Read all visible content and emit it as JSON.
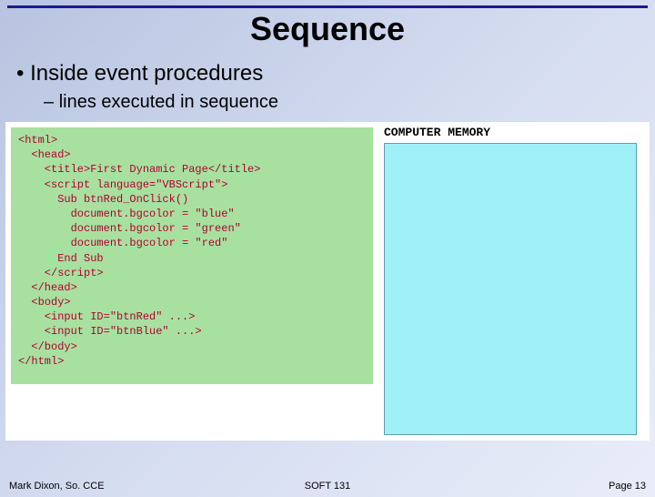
{
  "title": "Sequence",
  "bullets": {
    "level1": "Inside event procedures",
    "level2": "lines executed in sequence"
  },
  "code": "<html>\n  <head>\n    <title>First Dynamic Page</title>\n    <script language=\"VBScript\">\n      Sub btnRed_OnClick()\n        document.bgcolor = \"blue\"\n        document.bgcolor = \"green\"\n        document.bgcolor = \"red\"\n      End Sub\n    </script>\n  </head>\n  <body>\n    <input ID=\"btnRed\" ...>\n    <input ID=\"btnBlue\" ...>\n  </body>\n</html>",
  "memory_label": "COMPUTER MEMORY",
  "footer": {
    "left": "Mark Dixon, So. CCE",
    "center": "SOFT 131",
    "right": "Page 13"
  }
}
